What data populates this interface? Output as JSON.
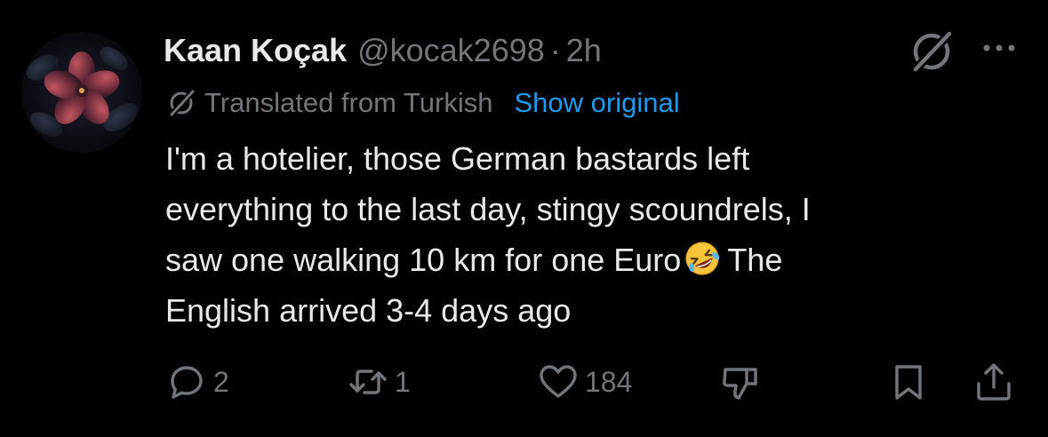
{
  "tweet": {
    "author": {
      "display_name": "Kaan Koçak",
      "handle": "@kocak2698",
      "separator": "·",
      "time": "2h"
    },
    "translation": {
      "label": "Translated from Turkish",
      "show_original": "Show original"
    },
    "body": {
      "line1": "I'm a hotelier, those German bastards left",
      "line2": "everything to the last day, stingy scoundrels, I",
      "line3_before_emoji": "saw one walking 10 km for one Euro",
      "line3_after_emoji": "The",
      "line4": "English arrived 3-4 days ago"
    },
    "actions": {
      "reply_count": "2",
      "retweet_count": "1",
      "like_count": "184"
    }
  },
  "icons": {
    "grok": "grok-icon",
    "more": "more-icon",
    "translate": "translate-icon",
    "emoji": "rolling-on-floor-laughing-emoji",
    "reply": "reply-icon",
    "retweet": "retweet-icon",
    "like": "heart-icon",
    "dislike": "dislike-icon",
    "bookmark": "bookmark-icon",
    "share": "share-icon"
  },
  "colors": {
    "background": "#000000",
    "primary_text": "#e7e9ea",
    "secondary_text": "#71767b",
    "link": "#1d9bf0"
  }
}
